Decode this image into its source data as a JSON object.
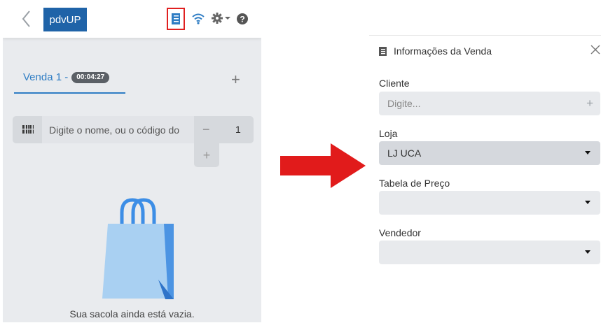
{
  "pos": {
    "logo_text": "pdvUP",
    "tab": {
      "label": "Venda 1 -",
      "timer": "00:04:27"
    },
    "add_tab": "+",
    "search": {
      "placeholder": "Digite o nome, ou o código do"
    },
    "quantity": {
      "minus": "−",
      "value": "1",
      "plus": "+"
    },
    "empty_message": "Sua sacola ainda está vazia."
  },
  "panel": {
    "title": "Informações da Venda",
    "fields": {
      "cliente": {
        "label": "Cliente",
        "placeholder": "Digite...",
        "add": "+"
      },
      "loja": {
        "label": "Loja",
        "value": "LJ UCA"
      },
      "tabela": {
        "label": "Tabela de Preço",
        "value": ""
      },
      "vendedor": {
        "label": "Vendedor",
        "value": ""
      }
    }
  },
  "colors": {
    "brand": "#1f63a8",
    "tab_accent": "#2f7dc4",
    "highlight": "#e02020",
    "arrow": "#e11b1b"
  },
  "icons": [
    "back-icon",
    "sale-info-icon",
    "wifi-icon",
    "gear-icon",
    "help-icon",
    "barcode-icon",
    "shopping-bag-icon",
    "close-icon",
    "caret-down-icon"
  ]
}
